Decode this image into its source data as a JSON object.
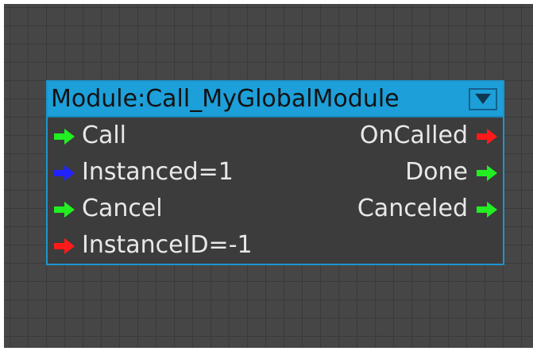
{
  "node": {
    "title": "Module:Call_MyGlobalModule",
    "collapse_icon": "triangle-down-icon",
    "inputs": [
      {
        "label": "Call",
        "color": "#22ee22"
      },
      {
        "label": "Instanced=1",
        "color": "#2222ff"
      },
      {
        "label": "Cancel",
        "color": "#22ee22"
      },
      {
        "label": "InstanceID=-1",
        "color": "#ff1a1a"
      }
    ],
    "outputs": [
      {
        "label": "OnCalled",
        "color": "#ff1a1a"
      },
      {
        "label": "Done",
        "color": "#22ee22"
      },
      {
        "label": "Canceled",
        "color": "#22ee22"
      }
    ]
  },
  "colors": {
    "canvas": "#464646",
    "grid": "#3a3a3a",
    "node_body": "#3c3c3c",
    "node_header": "#1d9fd9",
    "node_border": "#1b95cf"
  }
}
